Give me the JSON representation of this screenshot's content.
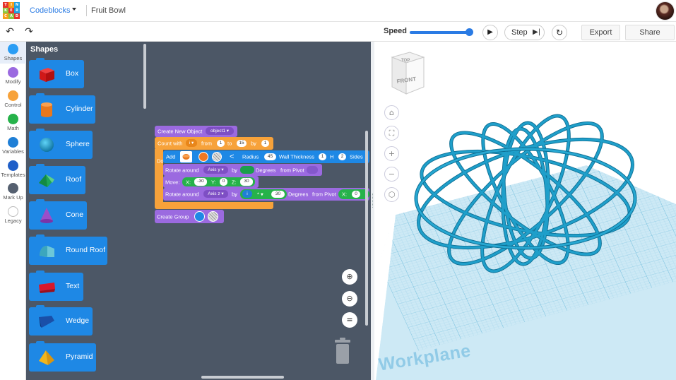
{
  "app": {
    "logo_letters": [
      "TIN",
      "KER",
      "CAD"
    ],
    "name": "Codeblocks",
    "document_title": "Fruit Bowl"
  },
  "toolbar": {
    "undo_icon": "undo-arrow-icon",
    "redo_icon": "redo-arrow-icon",
    "speed_label": "Speed",
    "speed_level_fraction": 0.92,
    "step_label": "Step",
    "export_label": "Export",
    "share_label": "Share"
  },
  "categories": [
    {
      "label": "Shapes",
      "color": "#2a9df4",
      "active": true
    },
    {
      "label": "Modify",
      "color": "#9b6ae0"
    },
    {
      "label": "Control",
      "color": "#f7a23a"
    },
    {
      "label": "Math",
      "color": "#26b24a"
    },
    {
      "label": "Variables",
      "color": "#1f7fd6"
    },
    {
      "label": "Templates",
      "color": "#1f5fc8"
    },
    {
      "label": "Mark Up",
      "color": "#556070"
    },
    {
      "label": "Legacy",
      "color": "#ffffff"
    }
  ],
  "palette": {
    "title": "Shapes",
    "shapes": [
      {
        "label": "Box",
        "icon": "box-icon"
      },
      {
        "label": "Cylinder",
        "icon": "cylinder-icon"
      },
      {
        "label": "Sphere",
        "icon": "sphere-icon"
      },
      {
        "label": "Roof",
        "icon": "roof-icon"
      },
      {
        "label": "Cone",
        "icon": "cone-icon"
      },
      {
        "label": "Round Roof",
        "icon": "round-roof-icon"
      },
      {
        "label": "Text",
        "icon": "text-shape-icon"
      },
      {
        "label": "Wedge",
        "icon": "wedge-icon"
      },
      {
        "label": "Pyramid",
        "icon": "pyramid-icon"
      }
    ]
  },
  "code": {
    "create_object": {
      "label": "Create New Object",
      "var": "object1"
    },
    "count": {
      "label": "Count with",
      "var": "i",
      "from_label": "from",
      "from": "1",
      "to_label": "to",
      "to": "15",
      "by_label": "by",
      "by": "1",
      "do_label": "Do"
    },
    "add": {
      "label": "Add",
      "radius_label": "Radius",
      "radius": "45",
      "wall_label": "Wall Thickness",
      "wall": "1",
      "h_label": "H",
      "h": "2",
      "sides_label": "Sides"
    },
    "rotate1": {
      "label": "Rotate around",
      "axis": "Axis y",
      "by_label": "by",
      "degrees_label": "Degrees",
      "pivot_label": "from Pivot"
    },
    "move": {
      "label": "Move:",
      "x_label": "X:",
      "x": "-30",
      "y_label": "Y:",
      "y": "0",
      "z_label": "Z:",
      "z": "30"
    },
    "rotate2": {
      "label": "Rotate around",
      "axis": "Axis z",
      "by_label": "by",
      "var": "i",
      "op": "*",
      "factor": "30",
      "degrees_label": "Degrees",
      "pivot_label": "from Pivot",
      "x_label": "X:",
      "x": "0"
    },
    "create_group": {
      "label": "Create Group"
    }
  },
  "workspace_controls": {
    "zoom_in_icon": "zoom-in-icon",
    "zoom_out_icon": "zoom-out-icon",
    "reset_label": "=",
    "trash_icon": "trash-icon"
  },
  "viewport": {
    "viewcube_top": "TOP",
    "viewcube_front": "FRONT",
    "nav_icons": [
      "home-icon",
      "fit-view-icon",
      "zoom-in-icon",
      "zoom-out-icon",
      "perspective-icon"
    ],
    "workplane_label": "Workplane",
    "model_color": "#1b8cb3",
    "grid_color": "#9fd3ea"
  }
}
